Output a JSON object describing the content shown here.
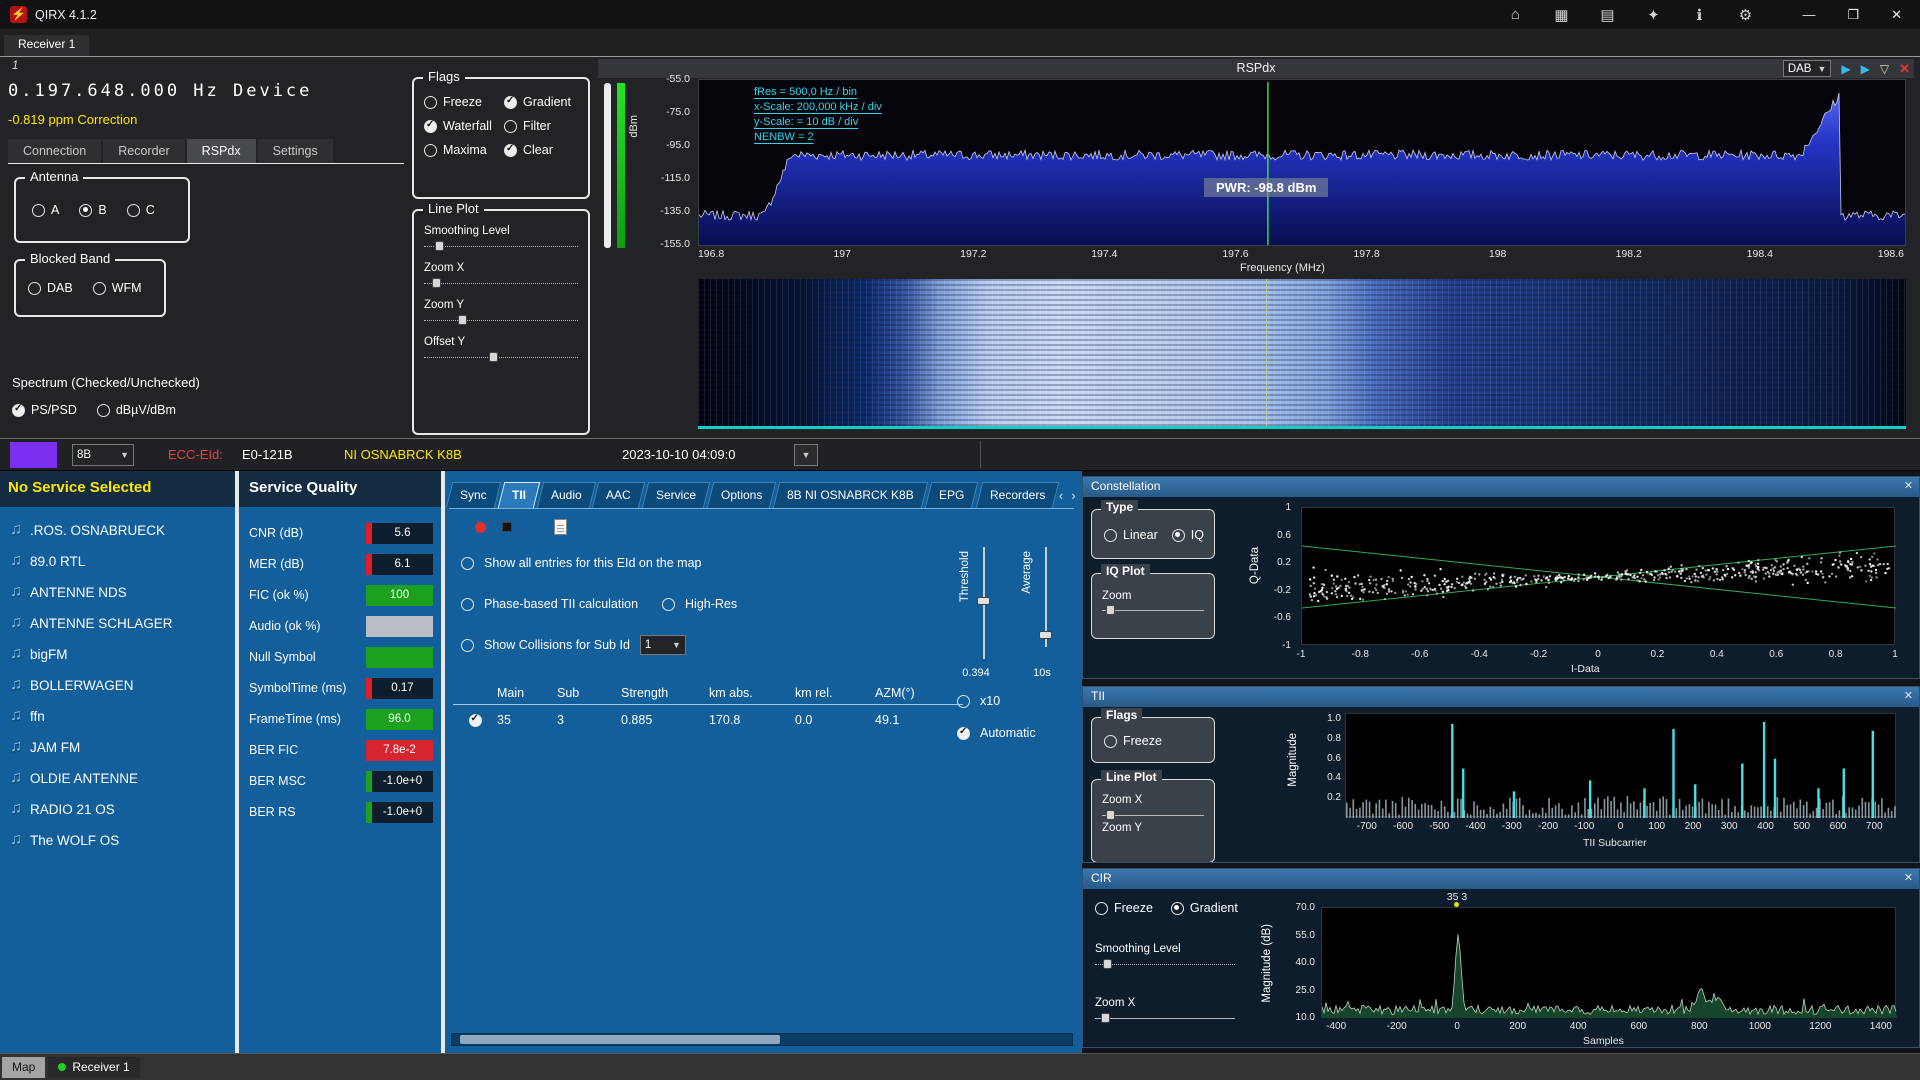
{
  "titlebar": {
    "title": "QIRX 4.1.2",
    "icons": [
      "home-icon",
      "grid-icon",
      "map-icon",
      "network-icon",
      "info-icon",
      "settings-icon"
    ],
    "window_buttons": [
      "minimize",
      "maximize",
      "close"
    ]
  },
  "receiver_tab": {
    "label": "Receiver 1"
  },
  "receiver": {
    "index": "1",
    "device_title": "RSPdx",
    "band_combo": "DAB",
    "frequency": "0.197.648.000 Hz Device",
    "correction": "-0.819 ppm Correction",
    "tabs": [
      "Connection",
      "Recorder",
      "RSPdx",
      "Settings"
    ],
    "active_tab": "RSPdx",
    "antenna": {
      "title": "Antenna",
      "options": [
        {
          "label": "A",
          "checked": false
        },
        {
          "label": "B",
          "checked": true
        },
        {
          "label": "C",
          "checked": false
        }
      ]
    },
    "blocked_band": {
      "title": "Blocked Band",
      "options": [
        {
          "label": "DAB",
          "checked": false
        },
        {
          "label": "WFM",
          "checked": false
        }
      ]
    },
    "spectrum_section": {
      "label": "Spectrum (Checked/Unchecked)",
      "options": [
        {
          "label": "PS/PSD",
          "checked": true,
          "type": "check"
        },
        {
          "label": "dBµV/dBm",
          "checked": false,
          "type": "radio"
        }
      ]
    },
    "flags": {
      "title": "Flags",
      "items": [
        {
          "label": "Freeze",
          "checked": false
        },
        {
          "label": "Gradient",
          "checked": true
        },
        {
          "label": "Waterfall",
          "checked": true
        },
        {
          "label": "Filter",
          "checked": false
        },
        {
          "label": "Maxima",
          "checked": false
        },
        {
          "label": "Clear",
          "checked": true
        }
      ]
    },
    "line_plot": {
      "title": "Line Plot",
      "sliders": [
        {
          "label": "Smoothing Level",
          "pos": 0.07
        },
        {
          "label": "Zoom X",
          "pos": 0.05
        },
        {
          "label": "Zoom Y",
          "pos": 0.22
        },
        {
          "label": "Offset Y",
          "pos": 0.42
        }
      ]
    }
  },
  "spectrum": {
    "y_unit": "dBm",
    "y_ticks": [
      "-55.0",
      "-75.0",
      "-95.0",
      "-115.0",
      "-135.0",
      "-155.0"
    ],
    "x_ticks": [
      "196.8",
      "197",
      "197.2",
      "197.4",
      "197.6",
      "197.8",
      "198",
      "198.2",
      "198.4",
      "198.6"
    ],
    "x_label": "Frequency (MHz)",
    "annotations": [
      "fRes = 500,0 Hz / bin",
      "x-Scale: 200,000 kHz / div",
      "y-Scale: = 10 dB / div",
      "NENBW = 2"
    ],
    "pwr_readout": "PWR: -98.8 dBm",
    "chart_data": {
      "type": "area",
      "x_range_mhz": [
        196.78,
        198.62
      ],
      "y_range_dbm": [
        -155,
        -55
      ],
      "plateau_dbm": -100.5,
      "noise_floor_dbm": -137,
      "plateau_mhz": [
        196.9,
        198.48
      ],
      "marker_mhz": 197.648
    }
  },
  "ensemble_bar": {
    "channel": "8B",
    "ecc_label": "ECC-EId:",
    "ecc_value": "E0-121B",
    "ensemble_name": "NI OSNABRCK K8B",
    "timestamp": "2023-10-10 04:09:0"
  },
  "services": {
    "header": "No Service Selected",
    "items": [
      ".ROS. OSNABRUECK",
      "89.0 RTL",
      "ANTENNE NDS",
      "ANTENNE SCHLAGER",
      "bigFM",
      "BOLLERWAGEN",
      "ffn",
      "JAM FM",
      "OLDIE ANTENNE",
      "RADIO 21 OS",
      "The WOLF OS"
    ]
  },
  "service_quality": {
    "title": "Service Quality",
    "rows": [
      {
        "label": "CNR (dB)",
        "value": "5.6",
        "style": "red-edge"
      },
      {
        "label": "MER (dB)",
        "value": "6.1",
        "style": "red-edge"
      },
      {
        "label": "FIC (ok %)",
        "value": "100",
        "style": "green"
      },
      {
        "label": "Audio (ok %)",
        "value": "",
        "style": "gray"
      },
      {
        "label": "Null Symbol",
        "value": "",
        "style": "green"
      },
      {
        "label": "SymbolTime (ms)",
        "value": "0.17",
        "style": "red-edge"
      },
      {
        "label": "FrameTime (ms)",
        "value": "96.0",
        "style": "green"
      },
      {
        "label": "BER FIC",
        "value": "7.8e-2",
        "style": "red"
      },
      {
        "label": "BER MSC",
        "value": "-1.0e+0",
        "style": "green-edge"
      },
      {
        "label": "BER RS",
        "value": "-1.0e+0",
        "style": "green-edge"
      }
    ]
  },
  "detail_tabs": {
    "tabs": [
      "Sync",
      "TII",
      "Audio",
      "AAC",
      "Service",
      "Options",
      "8B NI OSNABRCK K8B",
      "EPG",
      "Recorders"
    ],
    "active": "TII"
  },
  "tii_tab": {
    "check_map": {
      "label": "Show all entries for this EId on the map",
      "checked": false
    },
    "check_phase": {
      "label": "Phase-based TII calculation",
      "checked": false
    },
    "radio_highres": {
      "label": "High-Res",
      "checked": false
    },
    "check_collisions": {
      "label": "Show Collisions for Sub Id",
      "checked": false
    },
    "subid_combo": "1",
    "threshold": {
      "label": "Threshold",
      "value": "0.394"
    },
    "average": {
      "label": "Average",
      "value": "10s"
    },
    "radio_x10": {
      "label": "x10",
      "checked": false
    },
    "check_automatic": {
      "label": "Automatic",
      "checked": true
    },
    "table": {
      "headers": [
        "Main",
        "Sub",
        "Strength",
        "km abs.",
        "km rel.",
        "AZM(°)"
      ],
      "rows": [
        {
          "checked": true,
          "cells": [
            "35",
            "3",
            "0.885",
            "170.8",
            "0.0",
            "49.1"
          ]
        }
      ]
    }
  },
  "constellation": {
    "title": "Constellation",
    "close": "✕",
    "type_group": {
      "title": "Type",
      "options": [
        {
          "label": "Linear",
          "checked": false
        },
        {
          "label": "IQ",
          "checked": true
        }
      ]
    },
    "iq_group": {
      "title": "IQ Plot",
      "slider_label": "Zoom"
    },
    "plot": {
      "x_label": "I-Data",
      "y_label": "Q-Data",
      "x_ticks": [
        "-1",
        "-0.8",
        "-0.6",
        "-0.4",
        "-0.2",
        "0",
        "0.2",
        "0.4",
        "0.6",
        "0.8",
        "1"
      ],
      "y_ticks": [
        "1",
        "0.6",
        "0.2",
        "-0.2",
        "-0.6",
        "-1"
      ],
      "chart_data": {
        "type": "scatter",
        "x_range": [
          -1,
          1
        ],
        "y_range": [
          -1,
          1
        ],
        "envelope_slope": 0.45,
        "distribution": "bowtie-noise-cloud",
        "point_count": 560
      }
    }
  },
  "tii_panel": {
    "title": "TII",
    "close": "✕",
    "flags_group": {
      "title": "Flags",
      "options": [
        {
          "label": "Freeze",
          "checked": false
        }
      ]
    },
    "line_plot_group": {
      "title": "Line Plot",
      "sliders": [
        "Zoom X",
        "Zoom Y"
      ]
    },
    "plot": {
      "y_label": "Magnitude",
      "y_ticks": [
        "1.0",
        "0.8",
        "0.6",
        "0.4",
        "0.2"
      ],
      "x_ticks": [
        "-700",
        "-600",
        "-500",
        "-400",
        "-300",
        "-200",
        "-100",
        "0",
        "100",
        "200",
        "300",
        "400",
        "500",
        "600",
        "700"
      ],
      "x_label": "TII Subcarrier",
      "chart_data": {
        "type": "bar",
        "x_range": [
          -760,
          760
        ],
        "y_range": [
          0,
          1.05
        ],
        "spikes": [
          [
            -470,
            0.95
          ],
          [
            -440,
            0.5
          ],
          [
            -300,
            0.27
          ],
          [
            -90,
            0.38
          ],
          [
            60,
            0.3
          ],
          [
            140,
            0.9
          ],
          [
            200,
            0.34
          ],
          [
            330,
            0.55
          ],
          [
            390,
            0.97
          ],
          [
            420,
            0.6
          ],
          [
            540,
            0.3
          ],
          [
            610,
            0.5
          ],
          [
            690,
            0.88
          ]
        ]
      }
    }
  },
  "cir_panel": {
    "title": "CIR",
    "close": "✕",
    "flags": [
      {
        "label": "Freeze",
        "checked": false
      },
      {
        "label": "Gradient",
        "checked": true
      }
    ],
    "sliders": [
      {
        "label": "Smoothing Level",
        "pos": 0.06
      },
      {
        "label": "Zoom X",
        "pos": 0.04
      }
    ],
    "peak_label": "35 3",
    "plot": {
      "y_label": "Magnitude (dB)",
      "y_ticks": [
        "70.0",
        "55.0",
        "40.0",
        "25.0",
        "10.0"
      ],
      "x_ticks": [
        "-400",
        "-200",
        "0",
        "200",
        "400",
        "600",
        "800",
        "1000",
        "1200",
        "1400"
      ],
      "x_label": "Samples",
      "chart_data": {
        "type": "line",
        "x_range": [
          -450,
          1450
        ],
        "y_range_db": [
          10,
          70
        ],
        "noise_floor_db": 14,
        "peaks": [
          [
            0,
            55
          ],
          [
            800,
            25
          ],
          [
            850,
            21
          ]
        ]
      }
    }
  },
  "statusbar": {
    "tabs": [
      {
        "label": "Map",
        "active": false
      },
      {
        "label": "Receiver 1",
        "active": true
      }
    ]
  }
}
